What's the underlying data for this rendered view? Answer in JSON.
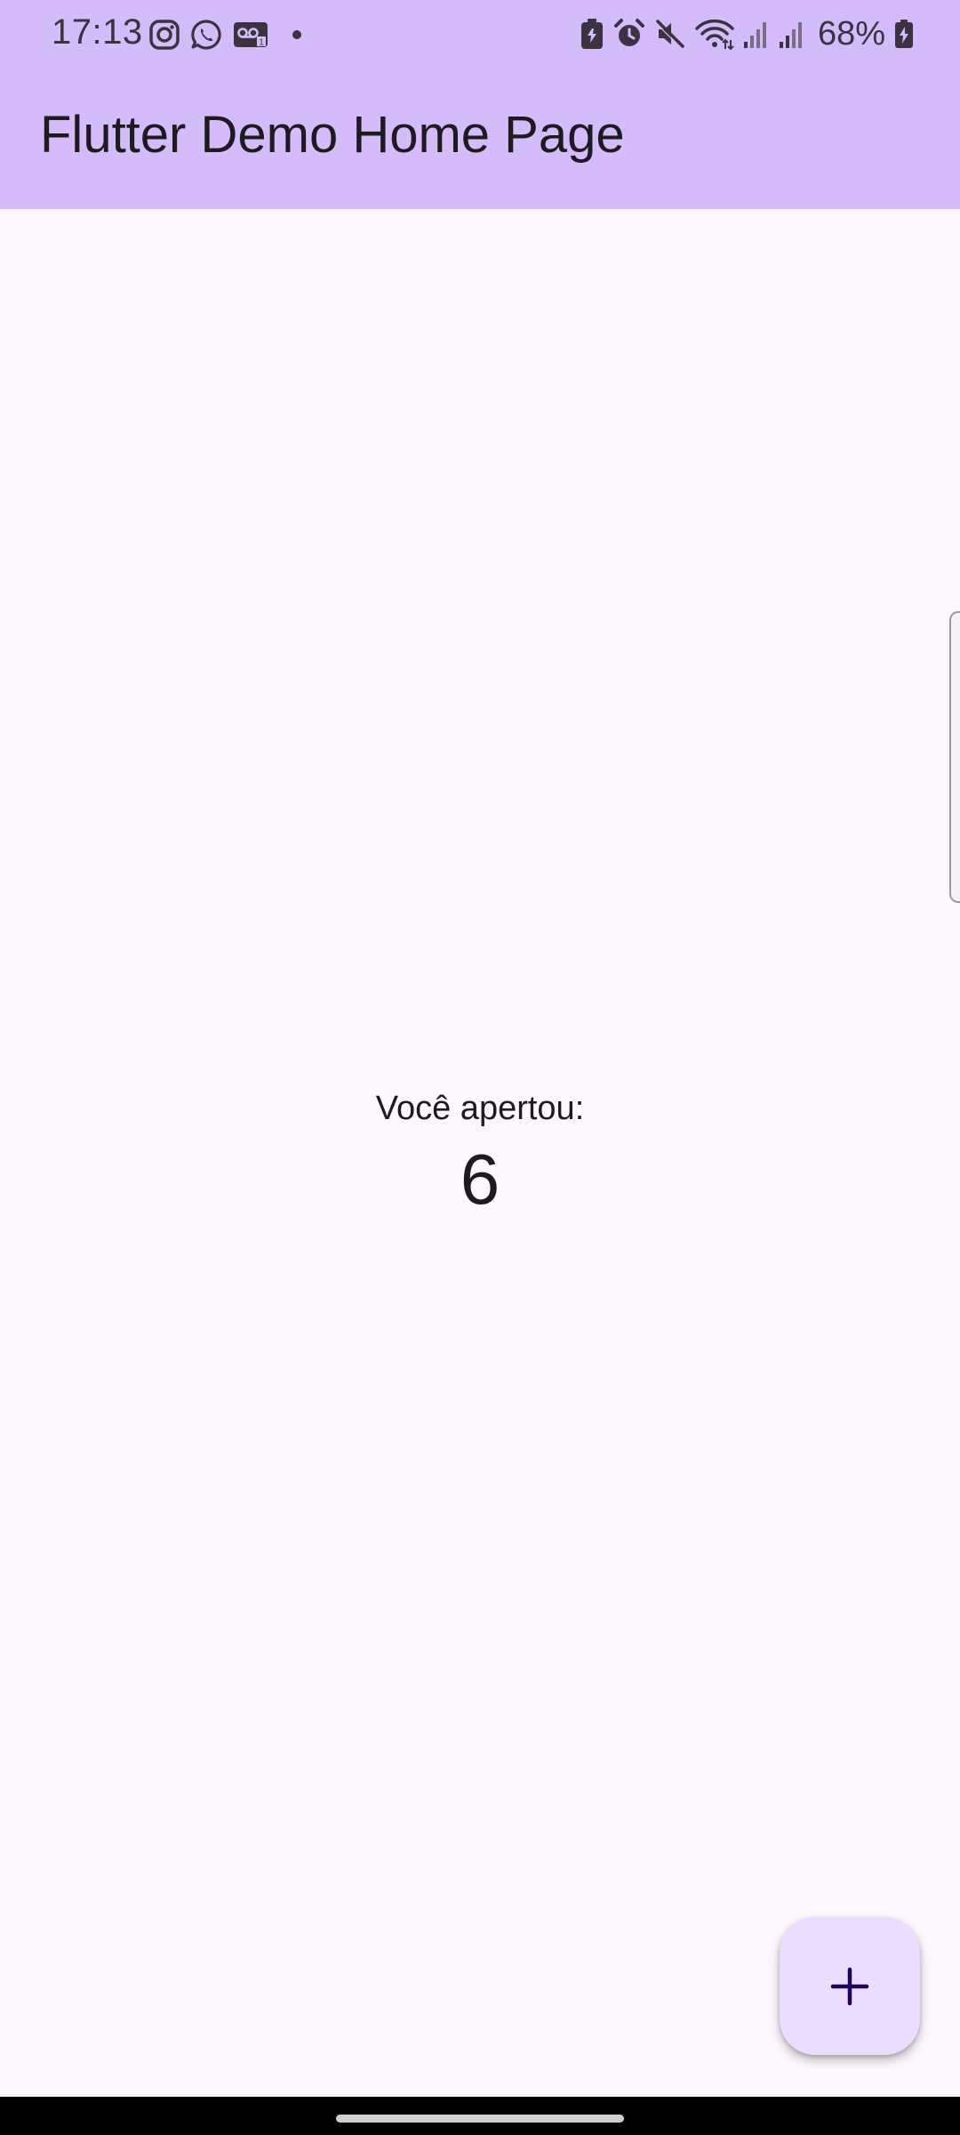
{
  "status_bar": {
    "time": "17:13",
    "battery": "68%",
    "left_icons": [
      "instagram-icon",
      "whatsapp-icon",
      "voicemail-icon",
      "dot-icon"
    ],
    "right_icons": [
      "battery-saver-icon",
      "alarm-icon",
      "mute-icon",
      "wifi-icon",
      "signal-1-icon",
      "signal-2-icon",
      "battery-charging-icon"
    ]
  },
  "app_bar": {
    "title": "Flutter Demo Home Page"
  },
  "counter": {
    "label": "Você apertou:",
    "value": "6"
  },
  "fab": {
    "icon": "plus-icon"
  },
  "colors": {
    "app_bar_bg": "#d4bcfa",
    "body_bg": "#fdf7fe",
    "fab_bg": "#eaddff",
    "text": "#1d1b20",
    "fab_icon": "#21005d"
  }
}
